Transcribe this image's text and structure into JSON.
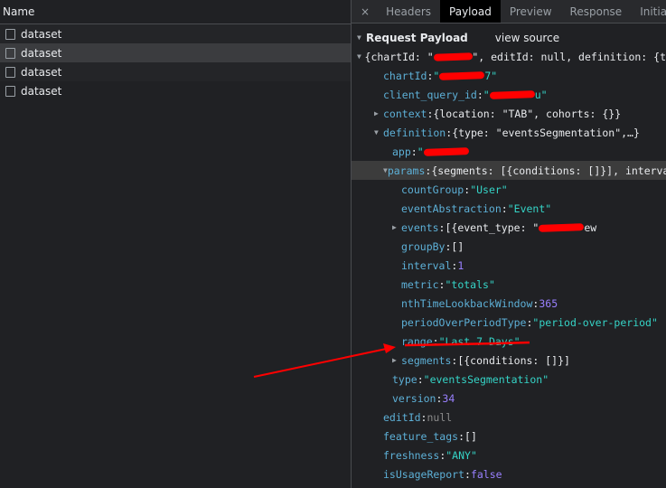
{
  "left": {
    "header": "Name",
    "rows": [
      {
        "name": "dataset"
      },
      {
        "name": "dataset",
        "selected": true
      },
      {
        "name": "dataset"
      },
      {
        "name": "dataset"
      }
    ]
  },
  "tabs": {
    "close": "×",
    "items": [
      "Headers",
      "Payload",
      "Preview",
      "Response",
      "Initiator"
    ],
    "active": "Payload"
  },
  "payload": {
    "title": "Request Payload",
    "view_source": "view source"
  },
  "lines": [
    {
      "indent": 0,
      "arrow": "down",
      "pre": "{chartId: \"",
      "redact": true,
      "post": "\", editId: null, definition: {t",
      "kind": "obj"
    },
    {
      "indent": 1,
      "key": "chartId",
      "pre": "\"",
      "redact": true,
      "post": "7\"",
      "kind": "str"
    },
    {
      "indent": 1,
      "key": "client_query_id",
      "pre": "\"",
      "redact": true,
      "post": "u\"",
      "kind": "str"
    },
    {
      "indent": 1,
      "arrow": "right",
      "key": "context",
      "value": "{location: \"TAB\", cohorts: {}}",
      "kind": "obj"
    },
    {
      "indent": 1,
      "arrow": "down",
      "key": "definition",
      "value": "{type: \"eventsSegmentation\",…}",
      "kind": "obj"
    },
    {
      "indent": 2,
      "key": "app",
      "pre": "\"",
      "redact": true,
      "post": "",
      "kind": "str"
    },
    {
      "indent": 2,
      "arrow": "down",
      "key": "params",
      "value": "{segments: [{conditions: []}], interval",
      "kind": "obj",
      "highlight": true
    },
    {
      "indent": 3,
      "key": "countGroup",
      "value": "\"User\"",
      "kind": "str"
    },
    {
      "indent": 3,
      "key": "eventAbstraction",
      "value": "\"Event\"",
      "kind": "str"
    },
    {
      "indent": 3,
      "arrow": "right",
      "key": "events",
      "pre": "[{event_type: \"",
      "redact": true,
      "post": "ew",
      "kind": "obj"
    },
    {
      "indent": 3,
      "key": "groupBy",
      "value": "[]",
      "kind": "obj"
    },
    {
      "indent": 3,
      "key": "interval",
      "value": "1",
      "kind": "num"
    },
    {
      "indent": 3,
      "key": "metric",
      "value": "\"totals\"",
      "kind": "str"
    },
    {
      "indent": 3,
      "key": "nthTimeLookbackWindow",
      "value": "365",
      "kind": "num"
    },
    {
      "indent": 3,
      "key": "periodOverPeriodType",
      "value": "\"period-over-period\"",
      "kind": "str"
    },
    {
      "indent": 3,
      "key": "range",
      "value": "\"Last 7 Days\"",
      "kind": "str"
    },
    {
      "indent": 3,
      "arrow": "right",
      "key": "segments",
      "value": "[{conditions: []}]",
      "kind": "obj"
    },
    {
      "indent": 2,
      "key": "type",
      "value": "\"eventsSegmentation\"",
      "kind": "str"
    },
    {
      "indent": 2,
      "key": "version",
      "value": "34",
      "kind": "num"
    },
    {
      "indent": 1,
      "key": "editId",
      "value": "null",
      "kind": "null"
    },
    {
      "indent": 1,
      "key": "feature_tags",
      "value": "[]",
      "kind": "obj"
    },
    {
      "indent": 1,
      "key": "freshness",
      "value": "\"ANY\"",
      "kind": "str"
    },
    {
      "indent": 1,
      "key": "isUsageReport",
      "value": "false",
      "kind": "bool"
    }
  ],
  "annotation_color": "#ff0000"
}
